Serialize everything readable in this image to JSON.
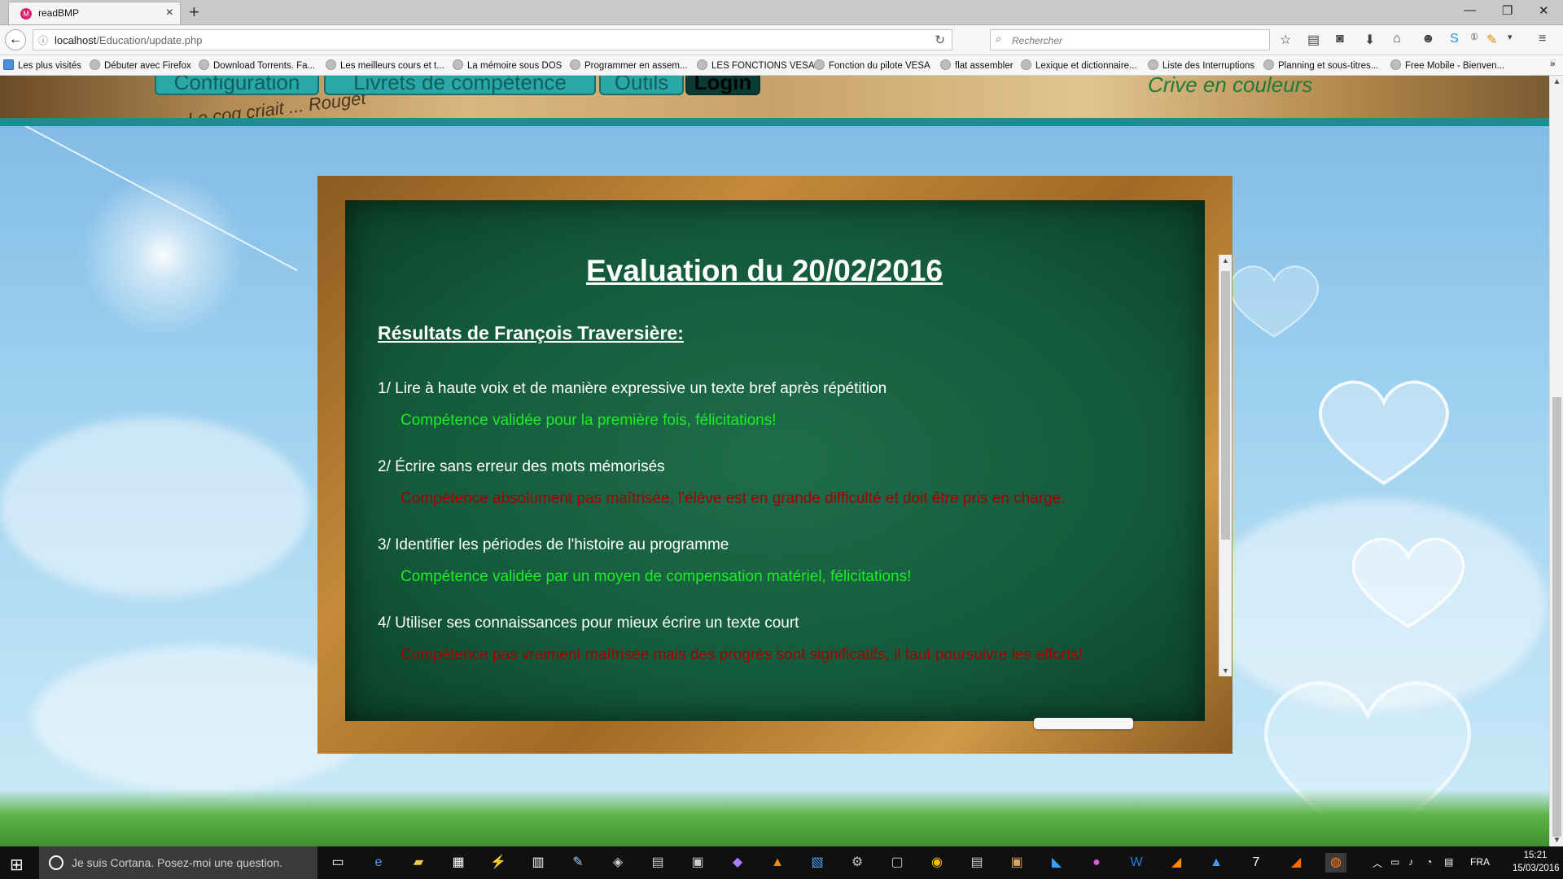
{
  "browser": {
    "tab_title": "readBMP",
    "tab_favicon": "readBMP-favicon-icon",
    "url_host": "localhost",
    "url_path": "/Education/update.php",
    "search_placeholder": "Rechercher",
    "bookmarks": [
      "Les plus visités",
      "Débuter avec Firefox",
      "Download Torrents. Fa...",
      "Les meilleurs cours et t...",
      "La mémoire sous DOS",
      "Programmer en assem...",
      "LES FONCTIONS VESA",
      "Fonction du pilote VESA",
      "flat assembler",
      "Lexique et dictionnaire...",
      "Liste des Interruptions",
      "Planning et sous-titres...",
      "Free Mobile - Bienven..."
    ],
    "overflow_label": "»"
  },
  "site": {
    "menu": [
      "Configuration",
      "Livrets de compétence",
      "Outils",
      "Login"
    ],
    "banner_text_left": "Le coq criait ... Rouget",
    "banner_text_right": "Crive en couleurs"
  },
  "evaluation": {
    "title": "Evaluation du 20/02/2016",
    "student_heading": "Résultats de François Traversière:",
    "items": [
      {
        "label": "1/ Lire à haute voix et de manière expressive un texte bref après répétition",
        "result": "Compétence validée pour la première fois, félicitations!",
        "status": "validated",
        "color": "#17f21c"
      },
      {
        "label": "2/ Écrire sans erreur des mots mémorisés",
        "result": "Compétence absolument pas maîtrisée, l'élève est en grande difficulté et doit être pris en charge.",
        "status": "failed",
        "color": "#a40000"
      },
      {
        "label": "3/ Identifier les périodes de l'histoire au programme",
        "result": "Compétence validée par un moyen de compensation matériel, félicitations!",
        "status": "validated",
        "color": "#17f21c"
      },
      {
        "label": "4/ Utiliser ses connaissances pour mieux écrire un texte court",
        "result": "Compétence pas vraiment maîtrisée mais des progrès sont significatifs, il faut poursuivre les efforts!",
        "status": "in-progress",
        "color": "#a40000"
      }
    ]
  },
  "taskbar": {
    "cortana_placeholder": "Je suis Cortana. Posez-moi une question.",
    "language": "FRA",
    "time": "15:21",
    "date": "15/03/2016"
  }
}
